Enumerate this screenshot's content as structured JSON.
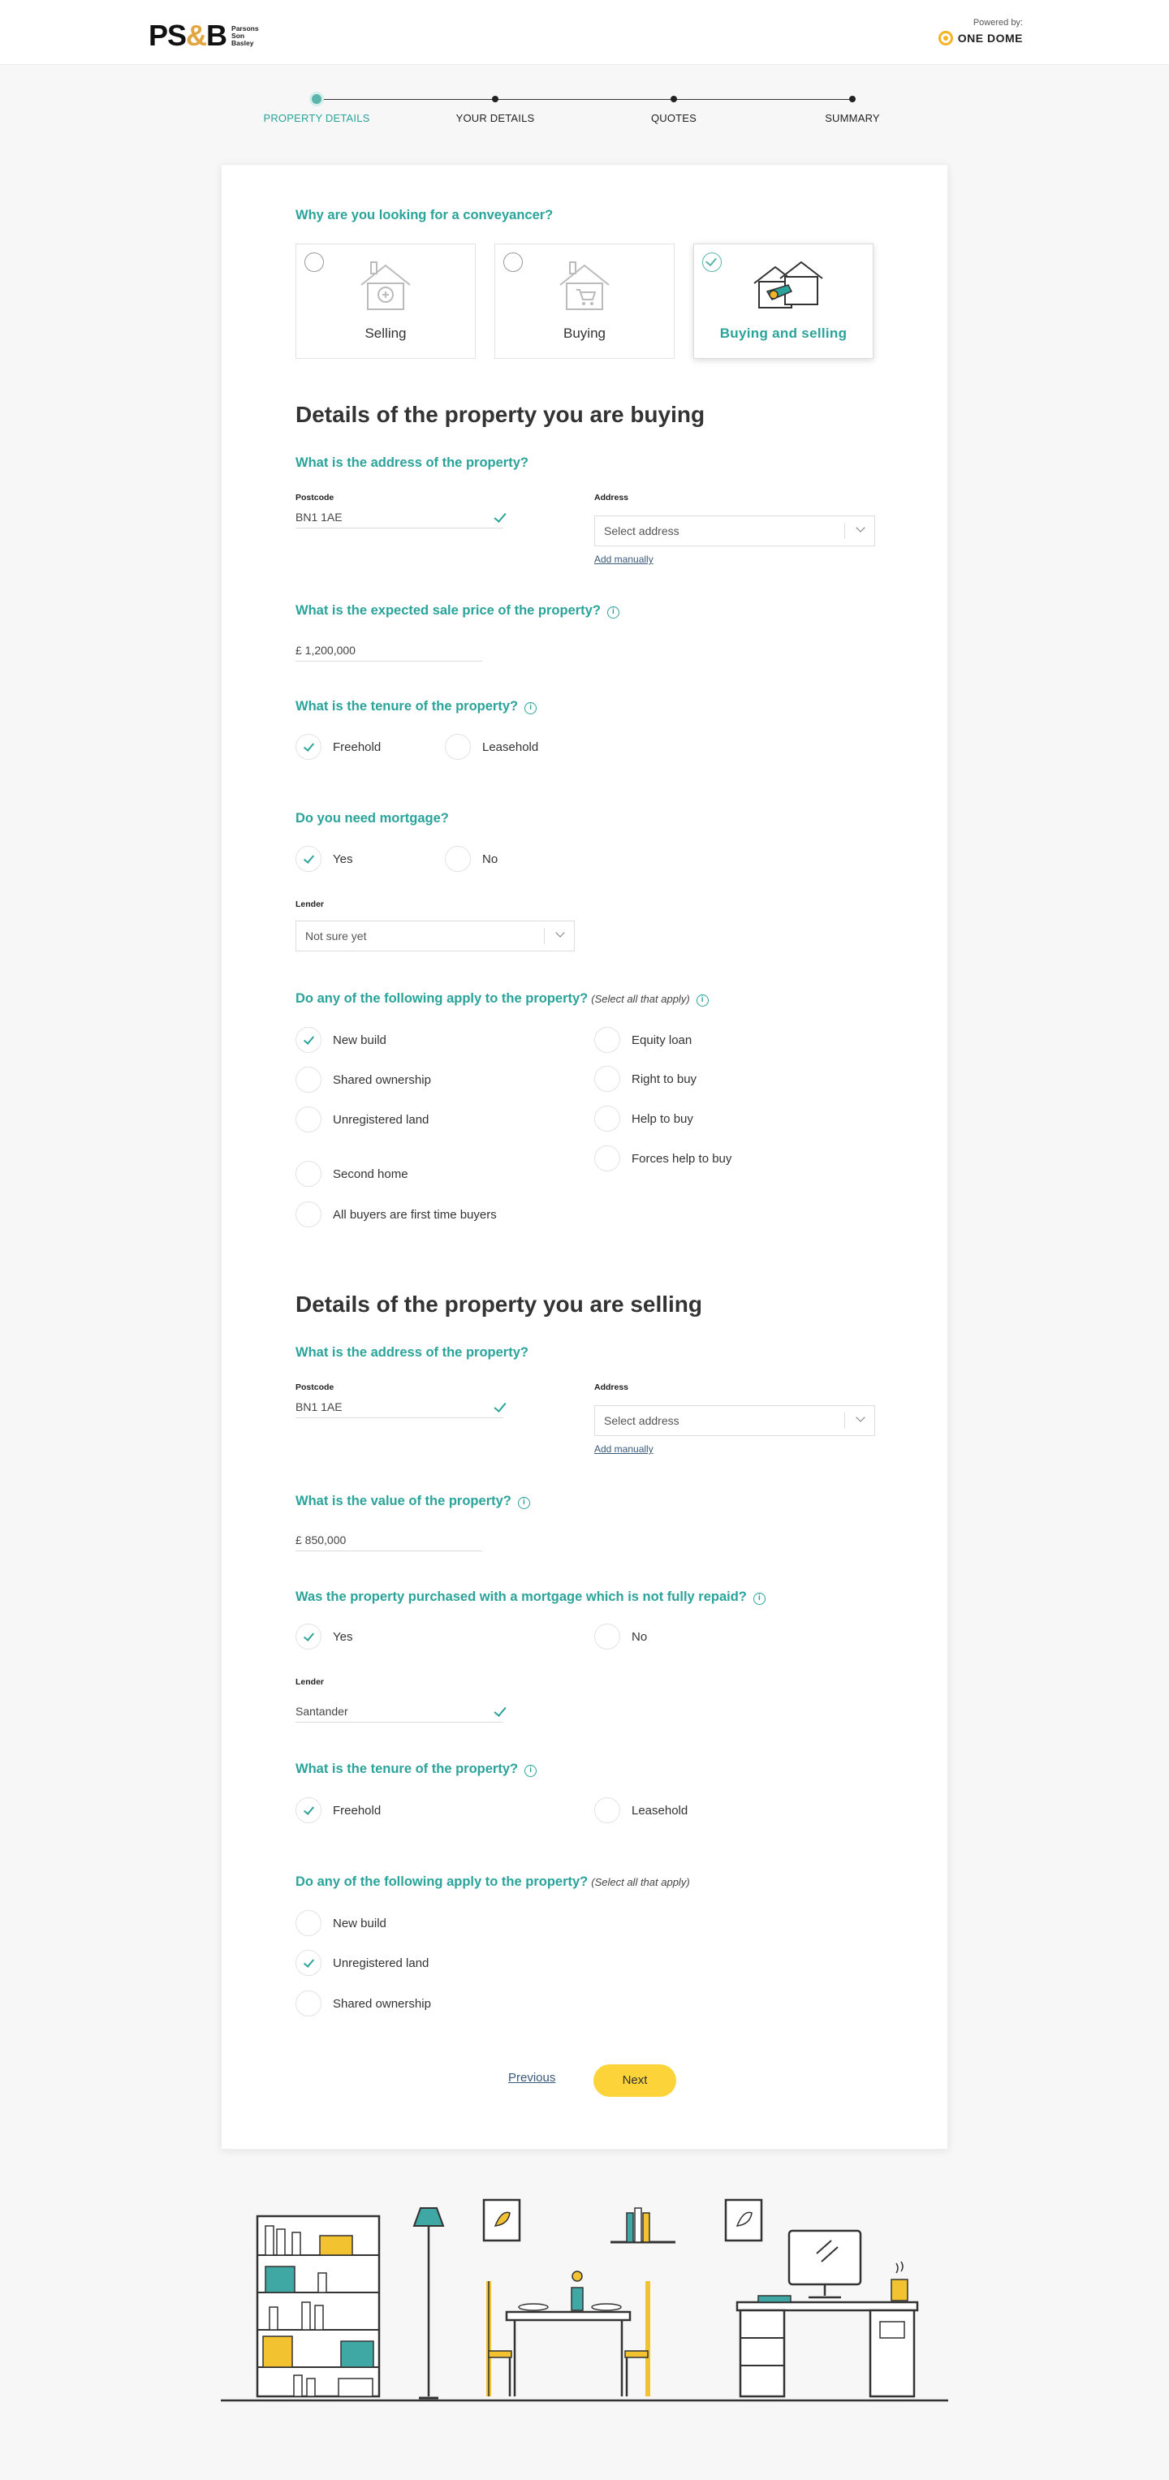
{
  "header": {
    "logo_main": "PS&B",
    "logo_sub": [
      "Parsons",
      "Son",
      "Basley"
    ],
    "powered_label": "Powered by:",
    "powered_brand": "ONE DOME"
  },
  "stepper": {
    "steps": [
      {
        "label": "PROPERTY DETAILS",
        "active": true
      },
      {
        "label": "YOUR DETAILS",
        "active": false
      },
      {
        "label": "QUOTES",
        "active": false
      },
      {
        "label": "SUMMARY",
        "active": false
      }
    ]
  },
  "reason": {
    "question": "Why are you looking for a conveyancer?",
    "options": [
      {
        "label": "Selling",
        "selected": false,
        "icon": "house-selling-icon"
      },
      {
        "label": "Buying",
        "selected": false,
        "icon": "house-buying-icon"
      },
      {
        "label": "Buying and selling",
        "selected": true,
        "icon": "houses-buying-selling-icon"
      }
    ]
  },
  "buying": {
    "title": "Details of the property you are buying",
    "address_question": "What is the address of the property?",
    "postcode_label": "Postcode",
    "postcode_value": "BN1 1AE",
    "address_label": "Address",
    "address_placeholder": "Select address",
    "add_manually": "Add manually",
    "price_question": "What is the expected sale price of the property?",
    "price_value": "£ 1,200,000",
    "tenure_question": "What is the tenure of the property?",
    "tenure_options": [
      {
        "label": "Freehold",
        "checked": true
      },
      {
        "label": "Leasehold",
        "checked": false
      }
    ],
    "mortgage_question": "Do you need mortgage?",
    "mortgage_options": [
      {
        "label": "Yes",
        "checked": true
      },
      {
        "label": "No",
        "checked": false
      }
    ],
    "lender_label": "Lender",
    "lender_value": "Not sure yet",
    "apply_question": "Do any of the following apply to the property?",
    "apply_hint": "(Select all that apply)",
    "apply_left": [
      {
        "label": "New build",
        "checked": true
      },
      {
        "label": "Shared ownership",
        "checked": false
      },
      {
        "label": "Unregistered land",
        "checked": false
      },
      {
        "label": "Second home",
        "checked": false
      },
      {
        "label": "All buyers are first time buyers",
        "checked": false
      }
    ],
    "apply_right": [
      {
        "label": "Equity loan",
        "checked": false
      },
      {
        "label": "Right to buy",
        "checked": false
      },
      {
        "label": "Help to buy",
        "checked": false
      },
      {
        "label": "Forces help to buy",
        "checked": false
      }
    ]
  },
  "selling": {
    "title": "Details of the property you are selling",
    "address_question": "What is the address of the property?",
    "postcode_label": "Postcode",
    "postcode_value": "BN1 1AE",
    "address_label": "Address",
    "address_placeholder": "Select address",
    "add_manually": "Add manually",
    "value_question": "What is the value of the property?",
    "value_value": "£ 850,000",
    "mortgage_question": "Was the property purchased with a mortgage which is not fully repaid?",
    "mortgage_options": [
      {
        "label": "Yes",
        "checked": true
      },
      {
        "label": "No",
        "checked": false
      }
    ],
    "lender_label": "Lender",
    "lender_value": "Santander",
    "tenure_question": "What is the tenure of the property?",
    "tenure_options": [
      {
        "label": "Freehold",
        "checked": true
      },
      {
        "label": "Leasehold",
        "checked": false
      }
    ],
    "apply_question": "Do any of the following apply to the property?",
    "apply_hint": "(Select all that apply)",
    "apply_list": [
      {
        "label": "New build",
        "checked": false
      },
      {
        "label": "Unregistered land",
        "checked": true
      },
      {
        "label": "Shared ownership",
        "checked": false
      }
    ]
  },
  "nav": {
    "previous": "Previous",
    "next": "Next"
  },
  "colors": {
    "accent": "#2aa39a",
    "button": "#fdd33a",
    "logo_amp": "#e2a53f"
  }
}
